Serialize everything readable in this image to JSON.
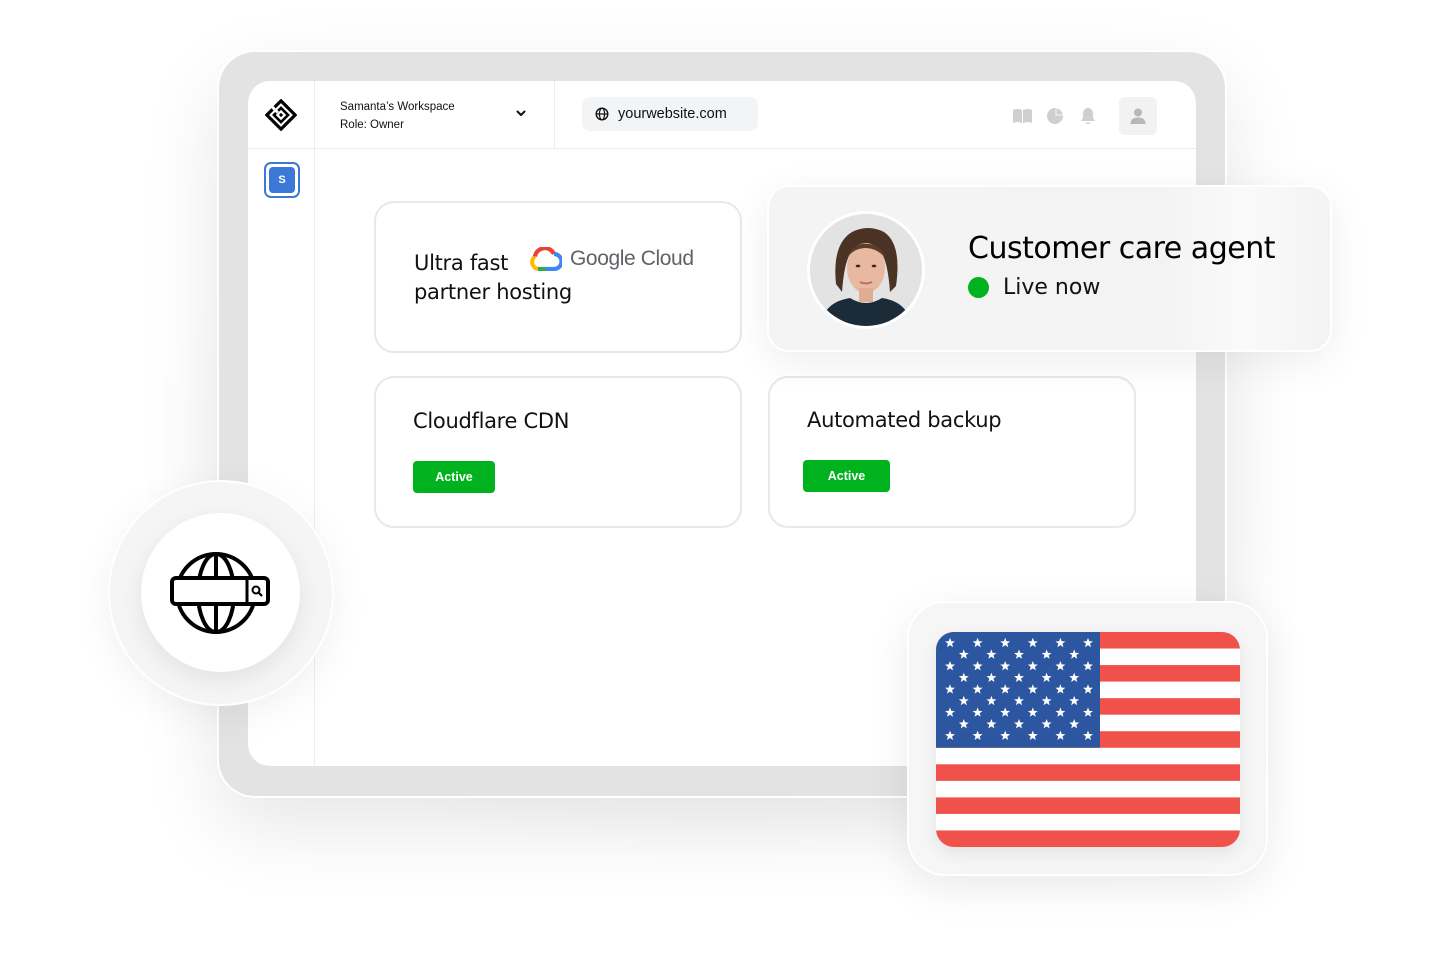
{
  "header": {
    "workspace_name": "Samanta’s Workspace",
    "workspace_role": "Role: Owner",
    "url": "yourwebsite.com",
    "icons": [
      "book-icon",
      "pie-chart-icon",
      "bell-icon",
      "user-icon"
    ]
  },
  "sidebar": {
    "workspace_initial": "S"
  },
  "cards": {
    "hosting": {
      "line1": "Ultra fast",
      "line2": "partner hosting",
      "partner_logo_text": "Google Cloud"
    },
    "cdn": {
      "title": "Cloudflare CDN",
      "status": "Active"
    },
    "backup": {
      "title": "Automated backup",
      "status": "Active"
    }
  },
  "agent": {
    "title": "Customer care agent",
    "status": "Live now",
    "status_color": "#00b21e"
  },
  "colors": {
    "accent_blue": "#3b78d8",
    "active_green": "#00b21e",
    "flag_blue": "#2c57a0",
    "flag_red": "#f0514b"
  },
  "floating": {
    "globe_icon": "globe-search-icon",
    "flag": "united-states-flag"
  }
}
